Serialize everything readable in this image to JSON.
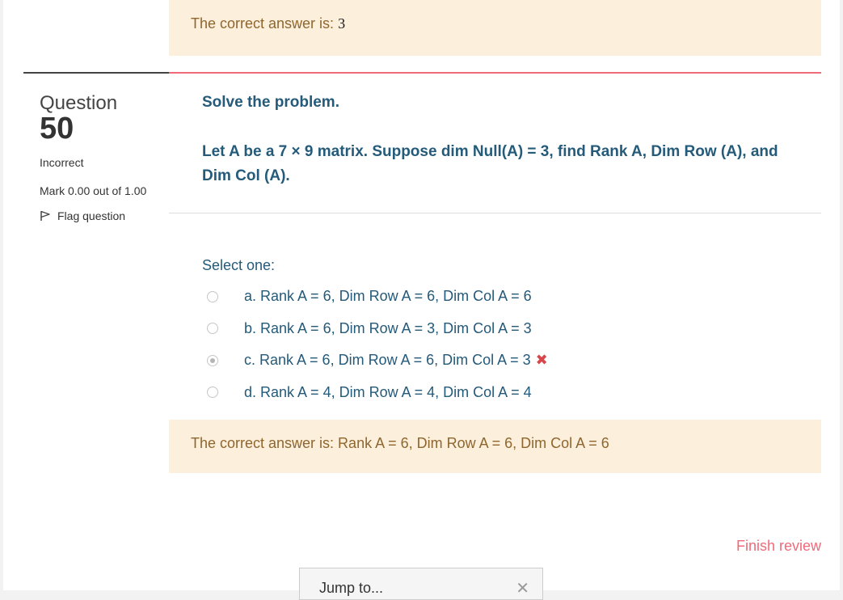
{
  "previous_feedback": {
    "prefix": "The correct answer is:",
    "answer": "3"
  },
  "question": {
    "label": "Question",
    "number": "50",
    "state": "Incorrect",
    "grade": "Mark 0.00 out of 1.00",
    "flag_label": "Flag question",
    "text_line1": "Solve the problem.",
    "text_line2": "Let A be a 7 × 9 matrix. Suppose dim Null(A) = 3, find Rank A, Dim Row (A), and Dim Col (A)."
  },
  "prompt": "Select one:",
  "answers": [
    {
      "label": "a. Rank A = 6, Dim Row A = 6, Dim Col A = 6",
      "selected": false
    },
    {
      "label": "b. Rank A = 6, Dim Row A = 3, Dim Col A = 3",
      "selected": false
    },
    {
      "label": "c. Rank A = 6, Dim Row A = 6, Dim Col A = 3",
      "selected": true,
      "mark": "✖"
    },
    {
      "label": "d. Rank A = 4, Dim Row A = 4, Dim Col A = 4",
      "selected": false
    }
  ],
  "feedback": {
    "text": "The correct answer is: Rank A = 6, Dim Row A = 6, Dim Col A = 6"
  },
  "finish_review": "Finish review",
  "jump_to": {
    "label": "Jump to...",
    "close": "✕"
  },
  "colors": {
    "accent": "#f06a7a",
    "question_text": "#245a7a",
    "feedback_bg": "#fcefdc",
    "feedback_text": "#8e662e",
    "wrong": "#d9464a"
  },
  "icons": {
    "flag": "flag-icon",
    "wrong": "wrong-mark-icon",
    "close": "close-icon"
  }
}
